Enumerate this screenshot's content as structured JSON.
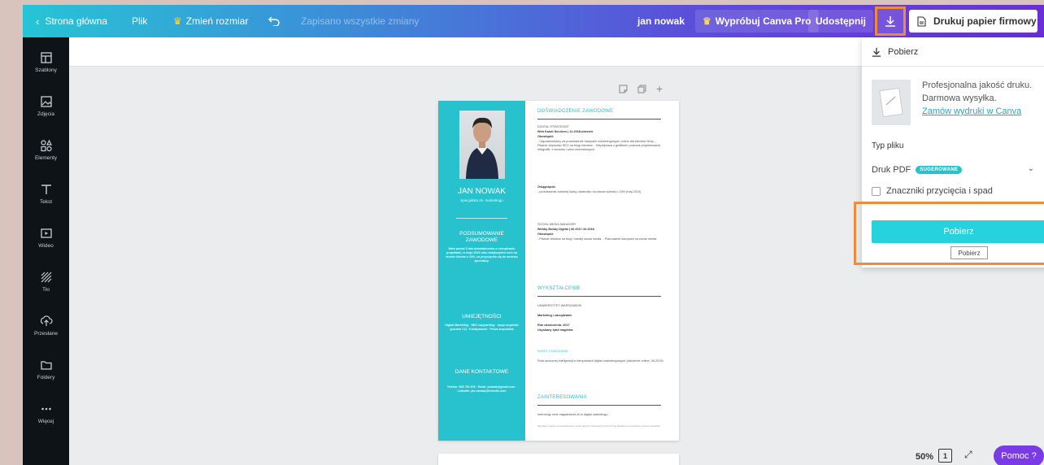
{
  "topbar": {
    "home": "Strona główna",
    "file": "Plik",
    "resize": "Zmień rozmiar",
    "saved_status": "Zapisano wszystkie zmiany",
    "user": "jan nowak",
    "try_pro": "Wypróbuj Canva Pro",
    "share": "Udostępnij",
    "print_button": "Drukuj papier firmowy"
  },
  "sidebar": {
    "items": [
      {
        "label": "Szablony",
        "icon": "templates-icon"
      },
      {
        "label": "Zdjęcia",
        "icon": "photos-icon"
      },
      {
        "label": "Elementy",
        "icon": "elements-icon"
      },
      {
        "label": "Tekst",
        "icon": "text-icon"
      },
      {
        "label": "Wideo",
        "icon": "video-icon"
      },
      {
        "label": "Tło",
        "icon": "background-icon"
      },
      {
        "label": "Przesłane",
        "icon": "upload-icon"
      },
      {
        "label": "Foldery",
        "icon": "folder-icon"
      },
      {
        "label": "Więcej",
        "icon": "more-icon"
      }
    ]
  },
  "download_panel": {
    "title": "Pobierz",
    "print_line1": "Profesjonalna jakość druku.",
    "print_line2": "Darmowa wysyłka.",
    "print_link": "Zamów wydruki w Canva",
    "file_type_label": "Typ pliku",
    "file_type_value": "Druk PDF",
    "file_type_badge": "SUGEROWANE",
    "crop_marks": "Znaczniki przycięcia i spad",
    "download_button": "Pobierz",
    "tooltip": "Pobierz"
  },
  "resume": {
    "name": "JAN NOWAK",
    "subtitle": "Specjalista ds. marketingu",
    "left_sections": [
      {
        "heading": "PODSUMOWANIE ZAWODOWE",
        "text": "Mam ponad 3 lata doświadczenia w zarządzaniu projektami, w maju 2019 roku zwiększyłem ruch na stronie klienta o 23%, co przyczyniło się do wzrostu sprzedaży."
      },
      {
        "heading": "UMIEJĘTNOŚCI",
        "text": "Digital Marketing · SEO copywriting · Język angielski (poziom C1) · Kreatywność · Praca zespołowa"
      },
      {
        "heading": "DANE KONTAKTOWE",
        "text": "Telefon: 545 792 878 · Email: jnowak@gmail.com · LinkedIn: jan.nowak@linkedin.com"
      }
    ],
    "experience_heading": "DOŚWIADCZENIE ZAWODOWE",
    "job1_title": "DIGITAL STRATEGIST",
    "job1_company": "Web Kandi Services | 11.2018-obecnie",
    "job1_duties_label": "Obowiązki:",
    "job1_duties": "- Odpowiedzialny za prowadzenie kampanii marketingowych online dla klientów firmy. - Pisanie artykułów SEO na blogi klientów. - Współpraca z grafikiem podczas projektowania infografik, e-booków i stron internetowych.",
    "job1_achievements_label": "Osiągnięcia:",
    "job1_achievements": "- podniesienie średniej liczby odwiedzin na stronie klienta o 23% (maj 2019)",
    "job2_title": "SOCIAL MEDIA MANAGER",
    "job2_company": "Webby Bobby Digital | 06.2017-10.2018",
    "job2_duties_label": "Obowiązki:",
    "job2_duties": "- Pisanie tekstów na blog i kanały social media. - Planowanie kampanii na social media.",
    "education_heading": "WYKSZTAŁCENIE",
    "edu_school": "UNIWERSYTET WARSZAWSKI",
    "edu_field": "Marketing i zarządzanie",
    "edu_year": "Rok ukończenia: 2017",
    "edu_degree": "Uzyskany tytuł magistra",
    "courses_heading": "KURSY I SZKOLENIA",
    "courses_text": "Rola sztucznej inteligencji w kampaniach digital marketingowych (szkolenie online, 06.2019)",
    "interests_heading": "ZAINTERESOWANIA",
    "interests_text": "Interesuję mnie zagadnienia AI w digital marketingu.",
    "footer_note": "Wyrażam zgodę na przetwarzanie moich danych osobowych przez Firmę Ziedtona na potrzeby procesu rekrutacji."
  },
  "bottom": {
    "zoom": "50%",
    "page_count": "1",
    "help": "Pomoc ?"
  },
  "colors": {
    "accent": "#27c2ce",
    "highlight": "#f08a3c",
    "help": "#7a3ae6"
  }
}
